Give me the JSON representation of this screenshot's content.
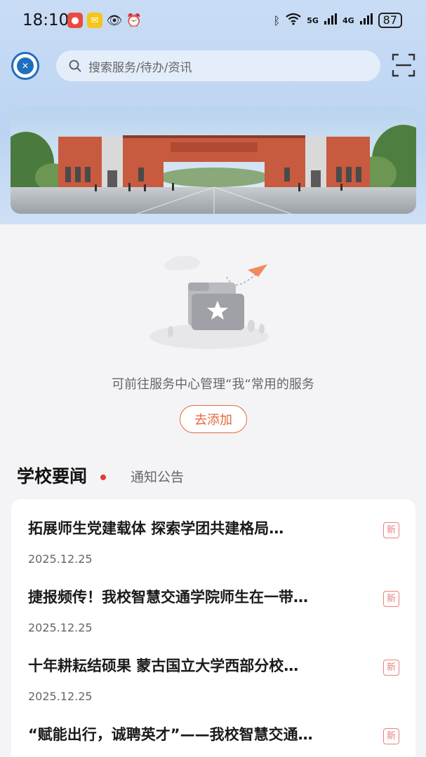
{
  "status_bar": {
    "time": "18:10",
    "network_label": "5G",
    "network_label_2": "4G",
    "battery": "87"
  },
  "header": {
    "search_placeholder": "搜索服务/待办/资讯"
  },
  "empty_state": {
    "message": "可前往服务中心管理“我“常用的服务",
    "add_label": "去添加"
  },
  "tabs": {
    "news": "学校要闻",
    "notice": "通知公告"
  },
  "news": [
    {
      "title": "拓展师生党建载体 探索学团共建格局…",
      "date": "2025.12.25",
      "badge": "新"
    },
    {
      "title": "捷报频传！我校智慧交通学院师生在一带…",
      "date": "2025.12.25",
      "badge": "新"
    },
    {
      "title": "十年耕耘结硕果 蒙古国立大学西部分校…",
      "date": "2025.12.25",
      "badge": "新"
    },
    {
      "title": "“赋能出行，诚聘英才”——我校智慧交通…",
      "date": "",
      "badge": "新"
    }
  ],
  "colors": {
    "accent": "#e2693c",
    "header_bg": "#c9dcf5",
    "badge": "#e9807c",
    "dot": "#e53935"
  }
}
